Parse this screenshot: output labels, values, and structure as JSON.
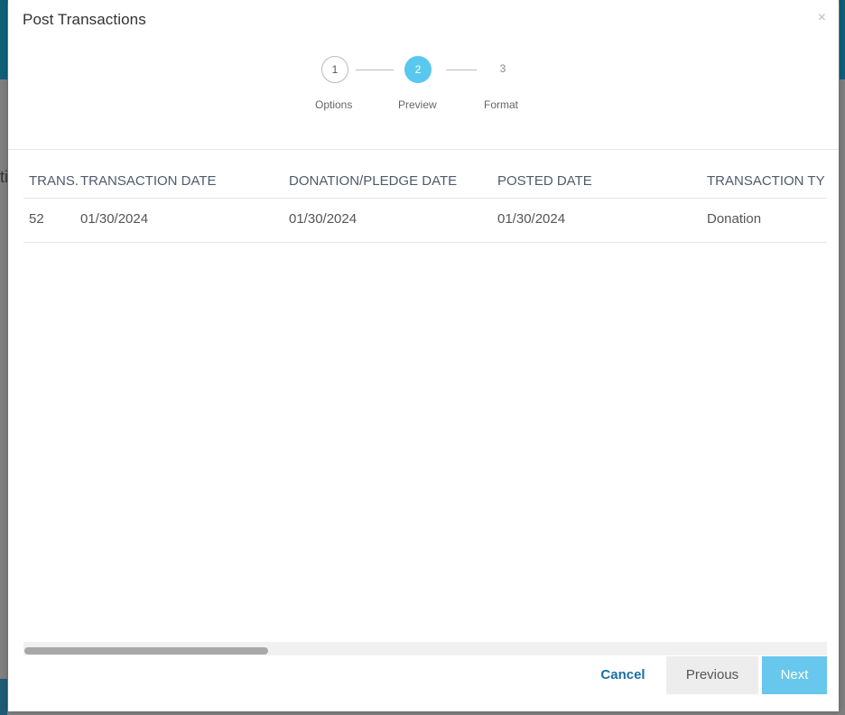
{
  "modal": {
    "title": "Post Transactions",
    "close_icon": "×"
  },
  "stepper": {
    "steps": [
      {
        "number": "1",
        "label": "Options",
        "state": "completed"
      },
      {
        "number": "2",
        "label": "Preview",
        "state": "active"
      },
      {
        "number": "3",
        "label": "Format",
        "state": "upcoming"
      }
    ],
    "active_color": "#5ac8ee"
  },
  "table": {
    "columns": [
      "TRANS.",
      "TRANSACTION DATE",
      "DONATION/PLEDGE DATE",
      "POSTED DATE",
      "TRANSACTION TY"
    ],
    "rows": [
      [
        "52",
        "01/30/2024",
        "01/30/2024",
        "01/30/2024",
        "Donation"
      ]
    ]
  },
  "background": {
    "partial_letter": "ti"
  },
  "buttons": {
    "cancel": "Cancel",
    "previous": "Previous",
    "next": "Next"
  }
}
